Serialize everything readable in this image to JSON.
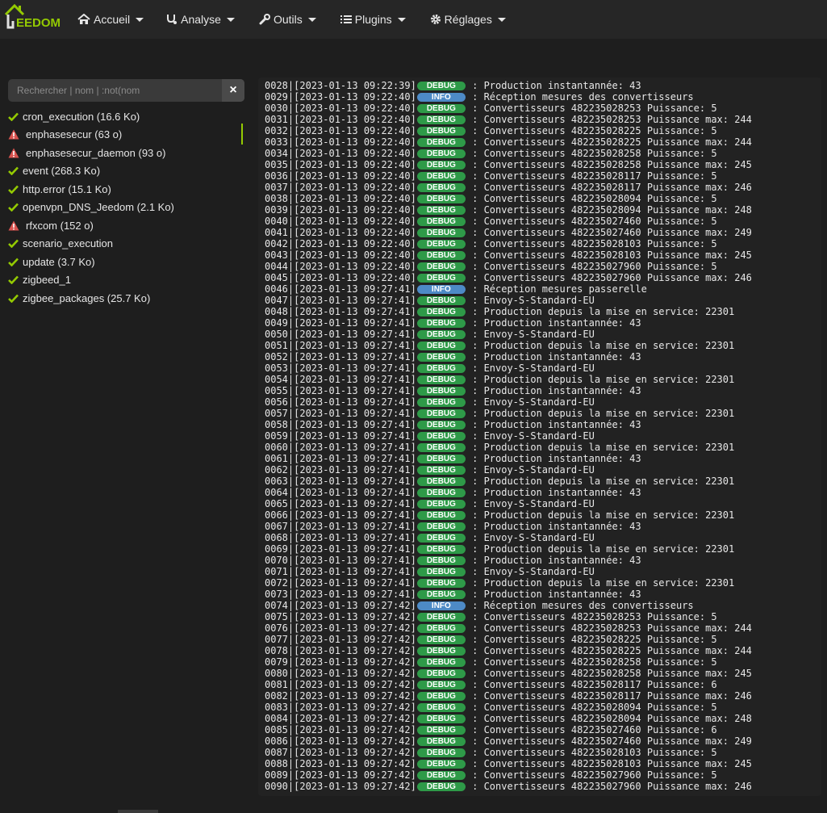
{
  "navbar": {
    "logo_text": "EEDOM",
    "items": [
      {
        "label": "Accueil",
        "icon": "home-icon"
      },
      {
        "label": "Analyse",
        "icon": "stethoscope-icon"
      },
      {
        "label": "Outils",
        "icon": "wrench-icon"
      },
      {
        "label": "Plugins",
        "icon": "list-icon"
      },
      {
        "label": "Réglages",
        "icon": "gear-icon"
      }
    ]
  },
  "sidebar": {
    "search_placeholder": "Rechercher | nom | :not(nom",
    "items": [
      {
        "label": "cron_execution (16.6 Ko)",
        "status": "ok"
      },
      {
        "label": "enphasesecur (63 o)",
        "status": "error",
        "active": true
      },
      {
        "label": "enphasesecur_daemon (93 o)",
        "status": "error"
      },
      {
        "label": "event (268.3 Ko)",
        "status": "ok"
      },
      {
        "label": "http.error (15.1 Ko)",
        "status": "ok"
      },
      {
        "label": "openvpn_DNS_Jeedom (2.1 Ko)",
        "status": "ok"
      },
      {
        "label": "rfxcom (152 o)",
        "status": "error"
      },
      {
        "label": "scenario_execution",
        "status": "ok"
      },
      {
        "label": "update (3.7 Ko)",
        "status": "ok"
      },
      {
        "label": "zigbeed_1",
        "status": "ok"
      },
      {
        "label": "zigbee_packages (25.7 Ko)",
        "status": "ok"
      }
    ]
  },
  "colors": {
    "accent": "#94ca02",
    "debug": "#2e9a48",
    "info": "#4d8ac6",
    "error": "#d9534f"
  },
  "log_lines": [
    {
      "num": "0028",
      "ts": "2023-01-13 09:22:39",
      "level": "DEBUG",
      "msg": "Production instantannée: 43"
    },
    {
      "num": "0029",
      "ts": "2023-01-13 09:22:40",
      "level": "INFO",
      "msg": "Réception mesures des convertisseurs"
    },
    {
      "num": "0030",
      "ts": "2023-01-13 09:22:40",
      "level": "DEBUG",
      "msg": "Convertisseurs 482235028253 Puissance: 5"
    },
    {
      "num": "0031",
      "ts": "2023-01-13 09:22:40",
      "level": "DEBUG",
      "msg": "Convertisseurs 482235028253 Puissance max: 244"
    },
    {
      "num": "0032",
      "ts": "2023-01-13 09:22:40",
      "level": "DEBUG",
      "msg": "Convertisseurs 482235028225 Puissance: 5"
    },
    {
      "num": "0033",
      "ts": "2023-01-13 09:22:40",
      "level": "DEBUG",
      "msg": "Convertisseurs 482235028225 Puissance max: 244"
    },
    {
      "num": "0034",
      "ts": "2023-01-13 09:22:40",
      "level": "DEBUG",
      "msg": "Convertisseurs 482235028258 Puissance: 5"
    },
    {
      "num": "0035",
      "ts": "2023-01-13 09:22:40",
      "level": "DEBUG",
      "msg": "Convertisseurs 482235028258 Puissance max: 245"
    },
    {
      "num": "0036",
      "ts": "2023-01-13 09:22:40",
      "level": "DEBUG",
      "msg": "Convertisseurs 482235028117 Puissance: 5"
    },
    {
      "num": "0037",
      "ts": "2023-01-13 09:22:40",
      "level": "DEBUG",
      "msg": "Convertisseurs 482235028117 Puissance max: 246"
    },
    {
      "num": "0038",
      "ts": "2023-01-13 09:22:40",
      "level": "DEBUG",
      "msg": "Convertisseurs 482235028094 Puissance: 5"
    },
    {
      "num": "0039",
      "ts": "2023-01-13 09:22:40",
      "level": "DEBUG",
      "msg": "Convertisseurs 482235028094 Puissance max: 248"
    },
    {
      "num": "0040",
      "ts": "2023-01-13 09:22:40",
      "level": "DEBUG",
      "msg": "Convertisseurs 482235027460 Puissance: 5"
    },
    {
      "num": "0041",
      "ts": "2023-01-13 09:22:40",
      "level": "DEBUG",
      "msg": "Convertisseurs 482235027460 Puissance max: 249"
    },
    {
      "num": "0042",
      "ts": "2023-01-13 09:22:40",
      "level": "DEBUG",
      "msg": "Convertisseurs 482235028103 Puissance: 5"
    },
    {
      "num": "0043",
      "ts": "2023-01-13 09:22:40",
      "level": "DEBUG",
      "msg": "Convertisseurs 482235028103 Puissance max: 245"
    },
    {
      "num": "0044",
      "ts": "2023-01-13 09:22:40",
      "level": "DEBUG",
      "msg": "Convertisseurs 482235027960 Puissance: 5"
    },
    {
      "num": "0045",
      "ts": "2023-01-13 09:22:40",
      "level": "DEBUG",
      "msg": "Convertisseurs 482235027960 Puissance max: 246"
    },
    {
      "num": "0046",
      "ts": "2023-01-13 09:27:41",
      "level": "INFO",
      "msg": "Réception mesures passerelle"
    },
    {
      "num": "0047",
      "ts": "2023-01-13 09:27:41",
      "level": "DEBUG",
      "msg": "Envoy-S-Standard-EU"
    },
    {
      "num": "0048",
      "ts": "2023-01-13 09:27:41",
      "level": "DEBUG",
      "msg": "Production depuis la mise en service: 22301"
    },
    {
      "num": "0049",
      "ts": "2023-01-13 09:27:41",
      "level": "DEBUG",
      "msg": "Production instantannée: 43"
    },
    {
      "num": "0050",
      "ts": "2023-01-13 09:27:41",
      "level": "DEBUG",
      "msg": "Envoy-S-Standard-EU"
    },
    {
      "num": "0051",
      "ts": "2023-01-13 09:27:41",
      "level": "DEBUG",
      "msg": "Production depuis la mise en service: 22301"
    },
    {
      "num": "0052",
      "ts": "2023-01-13 09:27:41",
      "level": "DEBUG",
      "msg": "Production instantannée: 43"
    },
    {
      "num": "0053",
      "ts": "2023-01-13 09:27:41",
      "level": "DEBUG",
      "msg": "Envoy-S-Standard-EU"
    },
    {
      "num": "0054",
      "ts": "2023-01-13 09:27:41",
      "level": "DEBUG",
      "msg": "Production depuis la mise en service: 22301"
    },
    {
      "num": "0055",
      "ts": "2023-01-13 09:27:41",
      "level": "DEBUG",
      "msg": "Production instantannée: 43"
    },
    {
      "num": "0056",
      "ts": "2023-01-13 09:27:41",
      "level": "DEBUG",
      "msg": "Envoy-S-Standard-EU"
    },
    {
      "num": "0057",
      "ts": "2023-01-13 09:27:41",
      "level": "DEBUG",
      "msg": "Production depuis la mise en service: 22301"
    },
    {
      "num": "0058",
      "ts": "2023-01-13 09:27:41",
      "level": "DEBUG",
      "msg": "Production instantannée: 43"
    },
    {
      "num": "0059",
      "ts": "2023-01-13 09:27:41",
      "level": "DEBUG",
      "msg": "Envoy-S-Standard-EU"
    },
    {
      "num": "0060",
      "ts": "2023-01-13 09:27:41",
      "level": "DEBUG",
      "msg": "Production depuis la mise en service: 22301"
    },
    {
      "num": "0061",
      "ts": "2023-01-13 09:27:41",
      "level": "DEBUG",
      "msg": "Production instantannée: 43"
    },
    {
      "num": "0062",
      "ts": "2023-01-13 09:27:41",
      "level": "DEBUG",
      "msg": "Envoy-S-Standard-EU"
    },
    {
      "num": "0063",
      "ts": "2023-01-13 09:27:41",
      "level": "DEBUG",
      "msg": "Production depuis la mise en service: 22301"
    },
    {
      "num": "0064",
      "ts": "2023-01-13 09:27:41",
      "level": "DEBUG",
      "msg": "Production instantannée: 43"
    },
    {
      "num": "0065",
      "ts": "2023-01-13 09:27:41",
      "level": "DEBUG",
      "msg": "Envoy-S-Standard-EU"
    },
    {
      "num": "0066",
      "ts": "2023-01-13 09:27:41",
      "level": "DEBUG",
      "msg": "Production depuis la mise en service: 22301"
    },
    {
      "num": "0067",
      "ts": "2023-01-13 09:27:41",
      "level": "DEBUG",
      "msg": "Production instantannée: 43"
    },
    {
      "num": "0068",
      "ts": "2023-01-13 09:27:41",
      "level": "DEBUG",
      "msg": "Envoy-S-Standard-EU"
    },
    {
      "num": "0069",
      "ts": "2023-01-13 09:27:41",
      "level": "DEBUG",
      "msg": "Production depuis la mise en service: 22301"
    },
    {
      "num": "0070",
      "ts": "2023-01-13 09:27:41",
      "level": "DEBUG",
      "msg": "Production instantannée: 43"
    },
    {
      "num": "0071",
      "ts": "2023-01-13 09:27:41",
      "level": "DEBUG",
      "msg": "Envoy-S-Standard-EU"
    },
    {
      "num": "0072",
      "ts": "2023-01-13 09:27:41",
      "level": "DEBUG",
      "msg": "Production depuis la mise en service: 22301"
    },
    {
      "num": "0073",
      "ts": "2023-01-13 09:27:41",
      "level": "DEBUG",
      "msg": "Production instantannée: 43"
    },
    {
      "num": "0074",
      "ts": "2023-01-13 09:27:42",
      "level": "INFO",
      "msg": "Réception mesures des convertisseurs"
    },
    {
      "num": "0075",
      "ts": "2023-01-13 09:27:42",
      "level": "DEBUG",
      "msg": "Convertisseurs 482235028253 Puissance: 5"
    },
    {
      "num": "0076",
      "ts": "2023-01-13 09:27:42",
      "level": "DEBUG",
      "msg": "Convertisseurs 482235028253 Puissance max: 244"
    },
    {
      "num": "0077",
      "ts": "2023-01-13 09:27:42",
      "level": "DEBUG",
      "msg": "Convertisseurs 482235028225 Puissance: 5"
    },
    {
      "num": "0078",
      "ts": "2023-01-13 09:27:42",
      "level": "DEBUG",
      "msg": "Convertisseurs 482235028225 Puissance max: 244"
    },
    {
      "num": "0079",
      "ts": "2023-01-13 09:27:42",
      "level": "DEBUG",
      "msg": "Convertisseurs 482235028258 Puissance: 5"
    },
    {
      "num": "0080",
      "ts": "2023-01-13 09:27:42",
      "level": "DEBUG",
      "msg": "Convertisseurs 482235028258 Puissance max: 245"
    },
    {
      "num": "0081",
      "ts": "2023-01-13 09:27:42",
      "level": "DEBUG",
      "msg": "Convertisseurs 482235028117 Puissance: 6"
    },
    {
      "num": "0082",
      "ts": "2023-01-13 09:27:42",
      "level": "DEBUG",
      "msg": "Convertisseurs 482235028117 Puissance max: 246"
    },
    {
      "num": "0083",
      "ts": "2023-01-13 09:27:42",
      "level": "DEBUG",
      "msg": "Convertisseurs 482235028094 Puissance: 5"
    },
    {
      "num": "0084",
      "ts": "2023-01-13 09:27:42",
      "level": "DEBUG",
      "msg": "Convertisseurs 482235028094 Puissance max: 248"
    },
    {
      "num": "0085",
      "ts": "2023-01-13 09:27:42",
      "level": "DEBUG",
      "msg": "Convertisseurs 482235027460 Puissance: 6"
    },
    {
      "num": "0086",
      "ts": "2023-01-13 09:27:42",
      "level": "DEBUG",
      "msg": "Convertisseurs 482235027460 Puissance max: 249"
    },
    {
      "num": "0087",
      "ts": "2023-01-13 09:27:42",
      "level": "DEBUG",
      "msg": "Convertisseurs 482235028103 Puissance: 5"
    },
    {
      "num": "0088",
      "ts": "2023-01-13 09:27:42",
      "level": "DEBUG",
      "msg": "Convertisseurs 482235028103 Puissance max: 245"
    },
    {
      "num": "0089",
      "ts": "2023-01-13 09:27:42",
      "level": "DEBUG",
      "msg": "Convertisseurs 482235027960 Puissance: 5"
    },
    {
      "num": "0090",
      "ts": "2023-01-13 09:27:42",
      "level": "DEBUG",
      "msg": "Convertisseurs 482235027960 Puissance max: 246"
    }
  ]
}
